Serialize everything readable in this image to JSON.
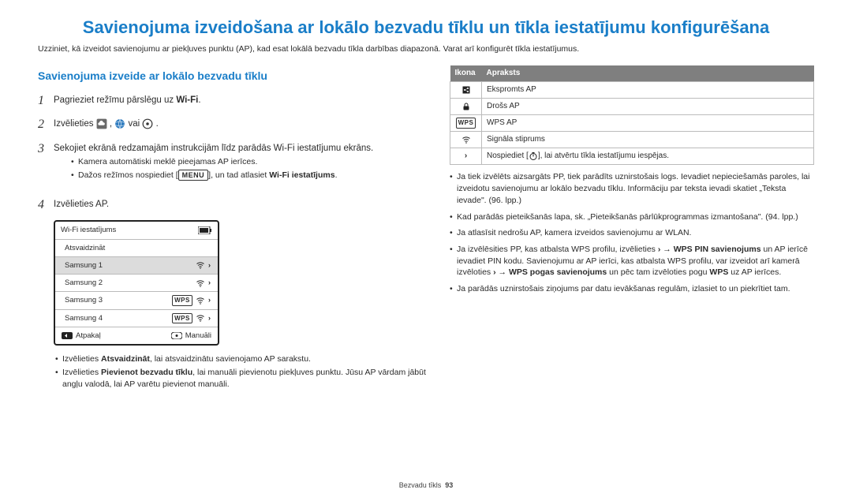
{
  "page": {
    "title": "Savienojuma izveidošana ar lokālo bezvadu tīklu un tīkla iestatījumu konfigurēšana",
    "intro": "Uzziniet, kā izveidot savienojumu ar piekļuves punktu (AP), kad esat lokālā bezvadu tīkla darbības diapazonā. Varat arī konfigurēt tīkla iestatījumus."
  },
  "section": {
    "title": "Savienojuma izveide ar lokālo bezvadu tīklu"
  },
  "steps": {
    "s1_pre": "Pagrieziet režīmu pārslēgu uz ",
    "s1_wifi": "Wi-Fi",
    "s1_post": ".",
    "s2_pre": "Izvēlieties ",
    "s2_mid": ", ",
    "s2_or": " vai ",
    "s2_post": ".",
    "s3_a": "Sekojiet ekrānā redzamajām instrukcijām līdz parādās Wi-Fi iestatījumu ekrāns.",
    "s3_b1": "Kamera automātiski meklē pieejamas AP ierīces.",
    "s3_b2_pre": "Dažos režīmos nospiediet [",
    "s3_menu": "MENU",
    "s3_b2_mid": "], un tad atlasiet ",
    "s3_b2_bold": "Wi-Fi iestatījums",
    "s3_b2_post": ".",
    "s4": "Izvēlieties AP."
  },
  "device": {
    "title": "Wi-Fi iestatījums",
    "refresh": "Atsvaidzināt",
    "items": [
      {
        "name": "Samsung 1",
        "wifi": true,
        "wps": false
      },
      {
        "name": "Samsung 2",
        "wifi": true,
        "wps": false
      },
      {
        "name": "Samsung 3",
        "wifi": true,
        "wps": true
      },
      {
        "name": "Samsung 4",
        "wifi": true,
        "wps": true
      }
    ],
    "back": "Atpakaļ",
    "manual": "Manuāli"
  },
  "afterDevice": {
    "b1_pre": "Izvēlieties ",
    "b1_bold": "Atsvaidzināt",
    "b1_post": ", lai atsvaidzinātu savienojamo AP sarakstu.",
    "b2_pre": "Izvēlieties ",
    "b2_bold": "Pievienot bezvadu tīklu",
    "b2_post": ", lai manuāli pievienotu piekļuves punktu. Jūsu AP vārdam jābūt angļu valodā, lai AP varētu pievienot manuāli."
  },
  "table": {
    "h1": "Ikona",
    "h2": "Apraksts",
    "r1": "Ekspromts AP",
    "r2": "Drošs AP",
    "r3": "WPS AP",
    "r4": "Signāla stiprums",
    "r5_pre": "Nospiediet [",
    "r5_post": "], lai atvērtu tīkla iestatījumu iespējas."
  },
  "right": {
    "li1": "Ja tiek izvēlēts aizsargāts PP, tiek parādīts uznirstošais logs. Ievadiet nepieciešamās paroles, lai izveidotu savienojumu ar lokālo bezvadu tīklu. Informāciju par teksta ievadi skatiet „Teksta ievade\". (96. lpp.)",
    "li2": "Kad parādās pieteikšanās lapa, sk. „Pieteikšanās pārlūkprogrammas izmantošana\". (94. lpp.)",
    "li3": "Ja atlasīsit nedrošu AP, kamera izveidos savienojumu ar WLAN.",
    "li4_a": "Ja izvēlēsities PP, kas atbalsta WPS profilu, izvēlieties ",
    "li4_arrow": " → ",
    "li4_b": "WPS PIN savienojums",
    "li4_c": " un AP ierīcē ievadiet PIN kodu. Savienojumu ar AP ierīci, kas atbalsta WPS profilu, var izveidot arī kamerā izvēloties ",
    "li4_d": "WPS pogas savienojums",
    "li4_e": " un pēc tam izvēloties pogu ",
    "li4_f": "WPS",
    "li4_g": " uz AP ierīces.",
    "li5": "Ja parādās uznirstošais ziņojums par datu ievākšanas regulām, izlasiet to un piekrītiet tam."
  },
  "footer": {
    "section": "Bezvadu tīkls",
    "page": "93"
  }
}
